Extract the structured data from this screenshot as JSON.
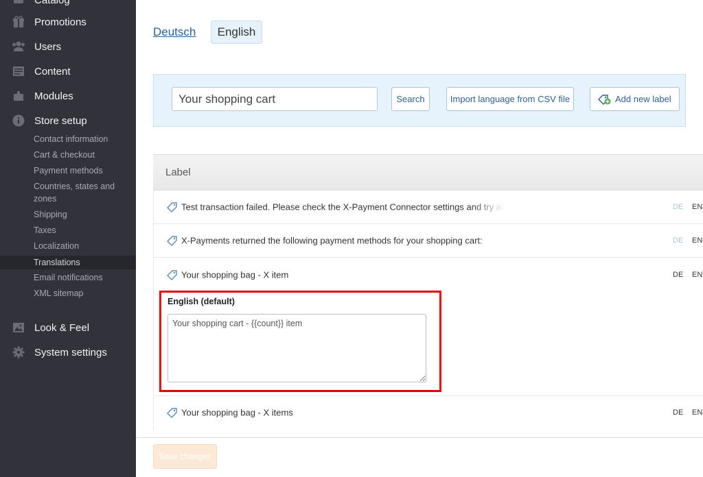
{
  "sidebar": {
    "top_partial": "Catalog",
    "items": [
      {
        "label": "Promotions",
        "icon": "gift-icon"
      },
      {
        "label": "Users",
        "icon": "users-icon"
      },
      {
        "label": "Content",
        "icon": "content-icon"
      },
      {
        "label": "Modules",
        "icon": "puzzle-icon"
      },
      {
        "label": "Store setup",
        "icon": "info-icon"
      }
    ],
    "sub_items": [
      "Contact information",
      "Cart & checkout",
      "Payment methods",
      "Countries, states and zones",
      "Shipping",
      "Taxes",
      "Localization",
      "Translations",
      "Email notifications",
      "XML sitemap"
    ],
    "bottom_items": [
      {
        "label": "Look & Feel",
        "icon": "image-icon"
      },
      {
        "label": "System settings",
        "icon": "gear-icon"
      }
    ]
  },
  "languages": {
    "other": "Deutsch",
    "current": "English"
  },
  "search": {
    "value": "Your shopping cart",
    "search_label": "Search",
    "import_label": "Import language from CSV file",
    "add_label": "Add new label"
  },
  "table": {
    "header": "Label",
    "rows": [
      {
        "label": "Test transaction failed. Please check the X-Payment Connector settings and try again",
        "de": "DE",
        "en": "EN"
      },
      {
        "label": "X-Payments returned the following payment methods for your shopping cart:",
        "de": "DE",
        "en": "EN"
      },
      {
        "label": "Your shopping bag - X item",
        "de": "DE",
        "en": "EN"
      },
      {
        "label": "Your shopping bag - X items",
        "de": "DE",
        "en": "EN"
      }
    ]
  },
  "editor": {
    "label": "English (default)",
    "value": "Your shopping cart - {{count}} item"
  },
  "footer": {
    "save_label": "Save changes"
  }
}
